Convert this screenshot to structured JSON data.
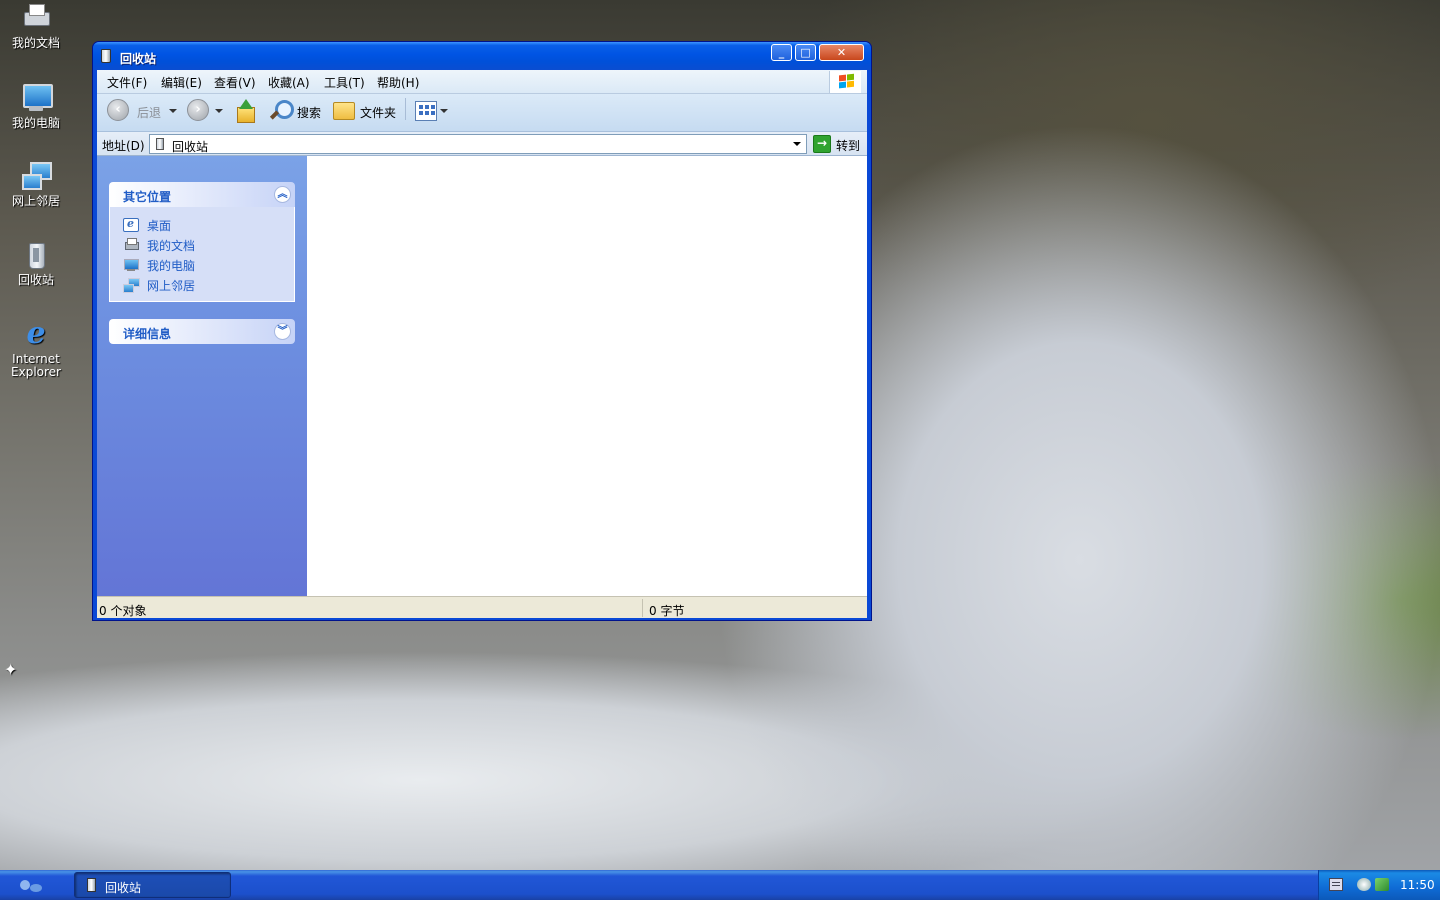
{
  "desktop": {
    "icons": [
      {
        "label": "我的文档",
        "icon": "printer-icon"
      },
      {
        "label": "我的电脑",
        "icon": "computer-icon"
      },
      {
        "label": "网上邻居",
        "icon": "network-icon"
      },
      {
        "label": "回收站",
        "icon": "recycle-bin-icon"
      },
      {
        "label_line1": "Internet",
        "label_line2": "Explorer",
        "icon": "internet-explorer-icon"
      }
    ]
  },
  "window": {
    "title": "回收站",
    "controls": {
      "minimize": "minimize-icon",
      "maximize": "maximize-icon",
      "close": "close-icon"
    },
    "menu": [
      {
        "label": "文件(F)"
      },
      {
        "label": "编辑(E)"
      },
      {
        "label": "查看(V)"
      },
      {
        "label": "收藏(A)"
      },
      {
        "label": "工具(T)"
      },
      {
        "label": "帮助(H)"
      }
    ],
    "toolbar": {
      "back_label": "后退",
      "search_label": "搜索",
      "folders_label": "文件夹"
    },
    "address": {
      "label": "地址(D)",
      "value": "回收站",
      "go_label": "转到"
    },
    "taskpane": {
      "other_places": {
        "title": "其它位置",
        "toggle": "collapse-icon",
        "links": [
          {
            "label": "桌面",
            "icon": "desktop-icon"
          },
          {
            "label": "我的文档",
            "icon": "my-documents-icon"
          },
          {
            "label": "我的电脑",
            "icon": "my-computer-icon"
          },
          {
            "label": "网上邻居",
            "icon": "network-places-icon"
          }
        ]
      },
      "details": {
        "title": "详细信息",
        "toggle": "expand-icon"
      }
    },
    "status": {
      "objects": "0 个对象",
      "size": "0 字节"
    }
  },
  "taskbar": {
    "task_button_label": "回收站",
    "clock": "11:50"
  },
  "colors": {
    "title_blue": "#0054e3",
    "taskpane_link": "#215dc6",
    "taskbar_blue": "#2157d7",
    "close_red": "#c8471d",
    "go_green": "#30a330"
  }
}
